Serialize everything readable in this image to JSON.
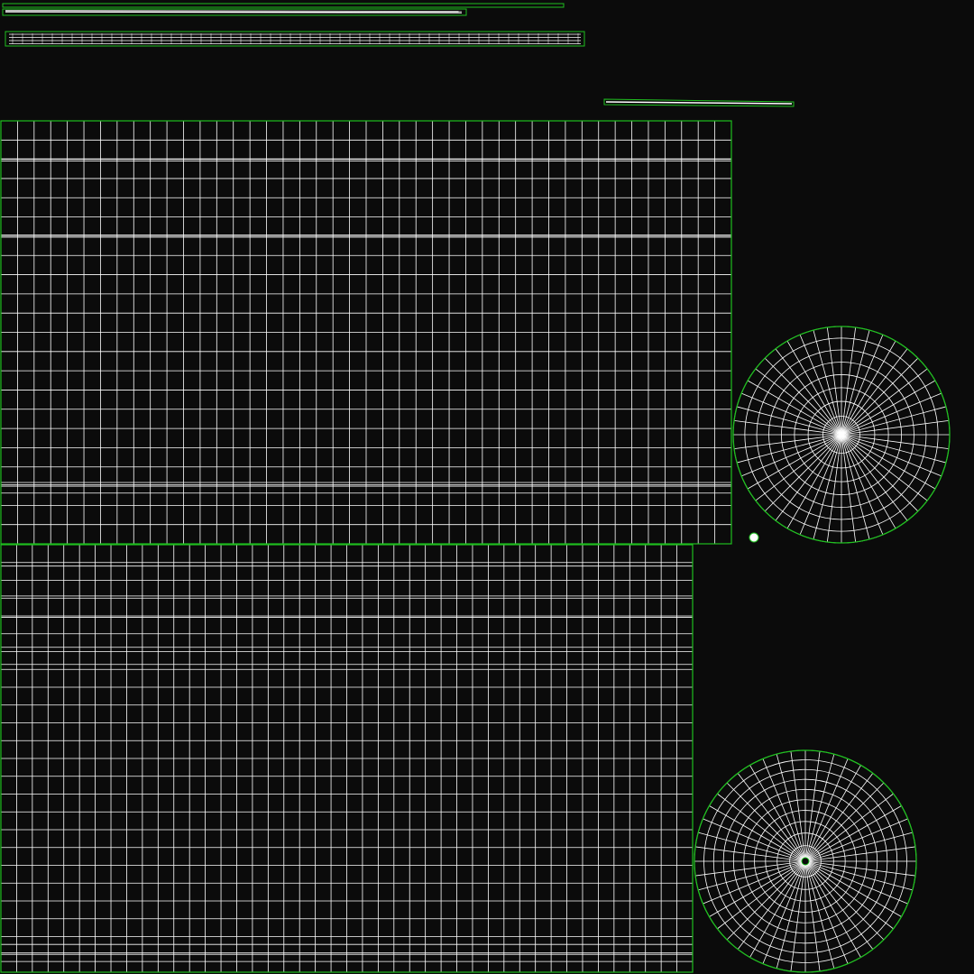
{
  "uv_layout": {
    "background_color": "#0b0b0b",
    "boundary_color": "#1fbf1f",
    "wire_color": "#ffffff",
    "islands": [
      {
        "name": "strip-top-1",
        "kind": "thin-strip"
      },
      {
        "name": "strip-top-2",
        "kind": "thin-strip"
      },
      {
        "name": "strip-top-3",
        "kind": "thin-strip"
      },
      {
        "name": "grid-upper",
        "kind": "grid",
        "columns": 44,
        "rows": 22
      },
      {
        "name": "grid-lower",
        "kind": "grid",
        "columns": 44,
        "rows": 24
      },
      {
        "name": "disc-right",
        "kind": "radial",
        "spokes": 48,
        "rings": 8
      },
      {
        "name": "disc-bottom",
        "kind": "radial",
        "spokes": 48,
        "rings": 10
      },
      {
        "name": "dot-small",
        "kind": "point"
      }
    ]
  }
}
